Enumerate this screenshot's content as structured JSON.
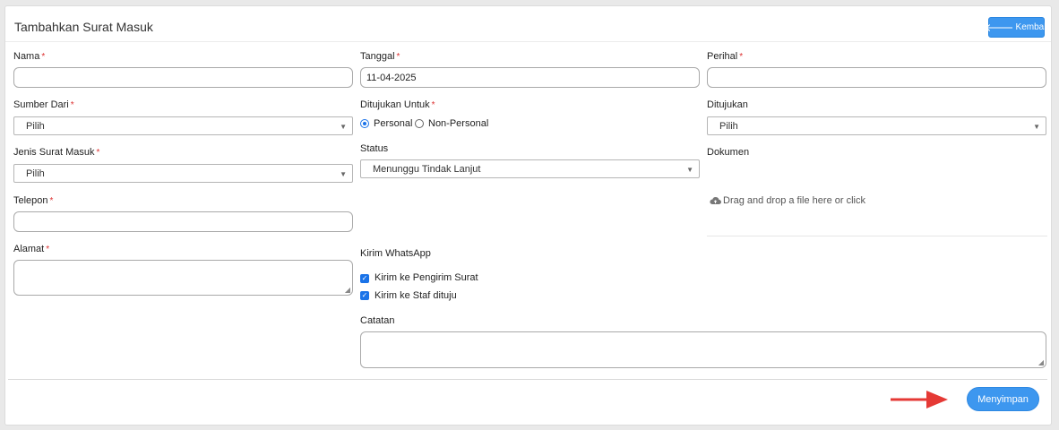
{
  "header": {
    "title": "Tambahkan Surat Masuk",
    "back_label": "Kembali"
  },
  "form": {
    "nama": {
      "label": "Nama",
      "required": "*",
      "value": ""
    },
    "tanggal": {
      "label": "Tanggal",
      "required": "*",
      "value": "11-04-2025"
    },
    "perihal": {
      "label": "Perihal",
      "required": "*",
      "value": ""
    },
    "sumber_dari": {
      "label": "Sumber Dari",
      "required": "*",
      "selected": "Pilih"
    },
    "ditujukan_untuk": {
      "label": "Ditujukan Untuk",
      "required": "*",
      "options": [
        "Personal",
        "Non-Personal"
      ],
      "selected": "Personal"
    },
    "ditujukan": {
      "label": "Ditujukan",
      "selected": "Pilih"
    },
    "jenis_surat_masuk": {
      "label": "Jenis Surat Masuk",
      "required": "*",
      "selected": "Pilih"
    },
    "status": {
      "label": "Status",
      "selected": "Menunggu Tindak Lanjut"
    },
    "dokumen": {
      "label": "Dokumen",
      "dropzone_text": "Drag and drop a file here or click"
    },
    "telepon": {
      "label": "Telepon",
      "required": "*",
      "value": ""
    },
    "alamat": {
      "label": "Alamat",
      "required": "*",
      "value": ""
    },
    "kirim_whatsapp": {
      "label": "Kirim WhatsApp",
      "options": [
        {
          "label": "Kirim ke Pengirim Surat",
          "checked": true
        },
        {
          "label": "Kirim ke Staf dituju",
          "checked": true
        }
      ]
    },
    "catatan": {
      "label": "Catatan",
      "value": ""
    }
  },
  "footer": {
    "save_label": "Menyimpan"
  },
  "colors": {
    "primary": "#3d97ef",
    "required": "#dd3333",
    "annotation_arrow": "#e53935"
  },
  "icons": {
    "back": "arrow-left-icon",
    "dropzone": "cloud-upload-icon",
    "select_caret": "caret-down-icon"
  }
}
